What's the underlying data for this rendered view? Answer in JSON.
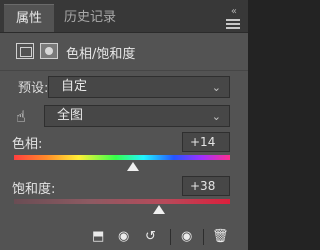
{
  "tabs": [
    {
      "label": "属性"
    },
    {
      "label": "历史记录"
    }
  ],
  "window": {
    "collapse": "«"
  },
  "panel": {
    "title": "色相/饱和度"
  },
  "preset": {
    "label": "预设:",
    "value": "自定"
  },
  "range": {
    "value": "全图"
  },
  "hue": {
    "label": "色相:",
    "value": "+14",
    "position": 0.55
  },
  "saturation": {
    "label": "饱和度:",
    "value": "+38",
    "position": 0.67
  },
  "footer": {
    "icons": [
      "clip-to-layer-icon",
      "view-previous-state-icon",
      "reset-icon",
      "visibility-icon",
      "delete-icon"
    ]
  }
}
